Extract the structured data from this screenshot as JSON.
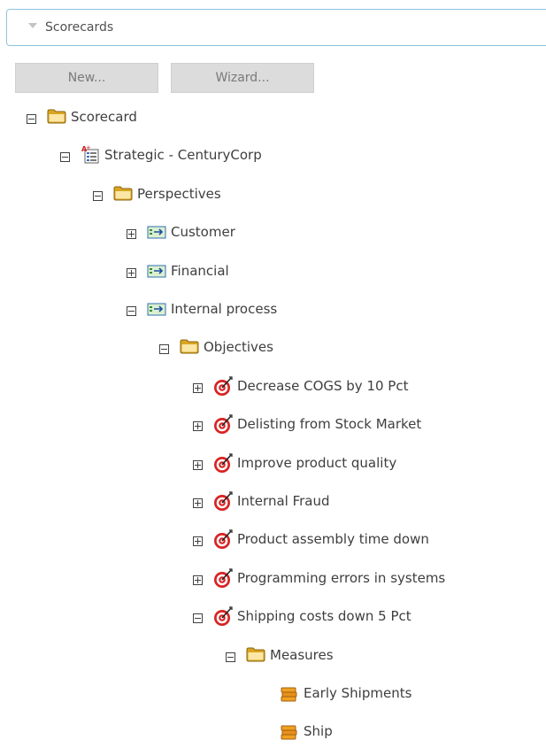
{
  "panel": {
    "title": "Scorecards"
  },
  "toolbar": {
    "new_label": "New...",
    "wizard_label": "Wizard..."
  },
  "tree": [
    {
      "label": "Scorecard",
      "level": 0,
      "toggle": "minus",
      "icon": "folder-icon"
    },
    {
      "label": "Strategic - CenturyCorp",
      "level": 1,
      "toggle": "minus",
      "icon": "scorecard-icon"
    },
    {
      "label": "Perspectives",
      "level": 2,
      "toggle": "minus",
      "icon": "folder-icon"
    },
    {
      "label": "Customer",
      "level": 3,
      "toggle": "plus",
      "icon": "perspective-icon"
    },
    {
      "label": "Financial",
      "level": 3,
      "toggle": "plus",
      "icon": "perspective-icon"
    },
    {
      "label": "Internal process",
      "level": 3,
      "toggle": "minus",
      "icon": "perspective-icon"
    },
    {
      "label": "Objectives",
      "level": 4,
      "toggle": "minus",
      "icon": "folder-icon"
    },
    {
      "label": "Decrease COGS by 10 Pct",
      "level": 5,
      "toggle": "plus",
      "icon": "target-icon"
    },
    {
      "label": "Delisting from Stock Market",
      "level": 5,
      "toggle": "plus",
      "icon": "target-icon"
    },
    {
      "label": "Improve product quality",
      "level": 5,
      "toggle": "plus",
      "icon": "target-icon"
    },
    {
      "label": "Internal Fraud",
      "level": 5,
      "toggle": "plus",
      "icon": "target-icon"
    },
    {
      "label": "Product assembly time down",
      "level": 5,
      "toggle": "plus",
      "icon": "target-icon"
    },
    {
      "label": "Programming errors in systems",
      "level": 5,
      "toggle": "plus",
      "icon": "target-icon"
    },
    {
      "label": "Shipping costs down 5 Pct",
      "level": 5,
      "toggle": "minus",
      "icon": "target-icon"
    },
    {
      "label": "Measures",
      "level": 6,
      "toggle": "minus",
      "icon": "folder-icon"
    },
    {
      "label": "Early Shipments",
      "level": 7,
      "toggle": "none",
      "icon": "measure-icon"
    },
    {
      "label": "Ship",
      "level": 7,
      "toggle": "none",
      "icon": "measure-icon"
    }
  ]
}
